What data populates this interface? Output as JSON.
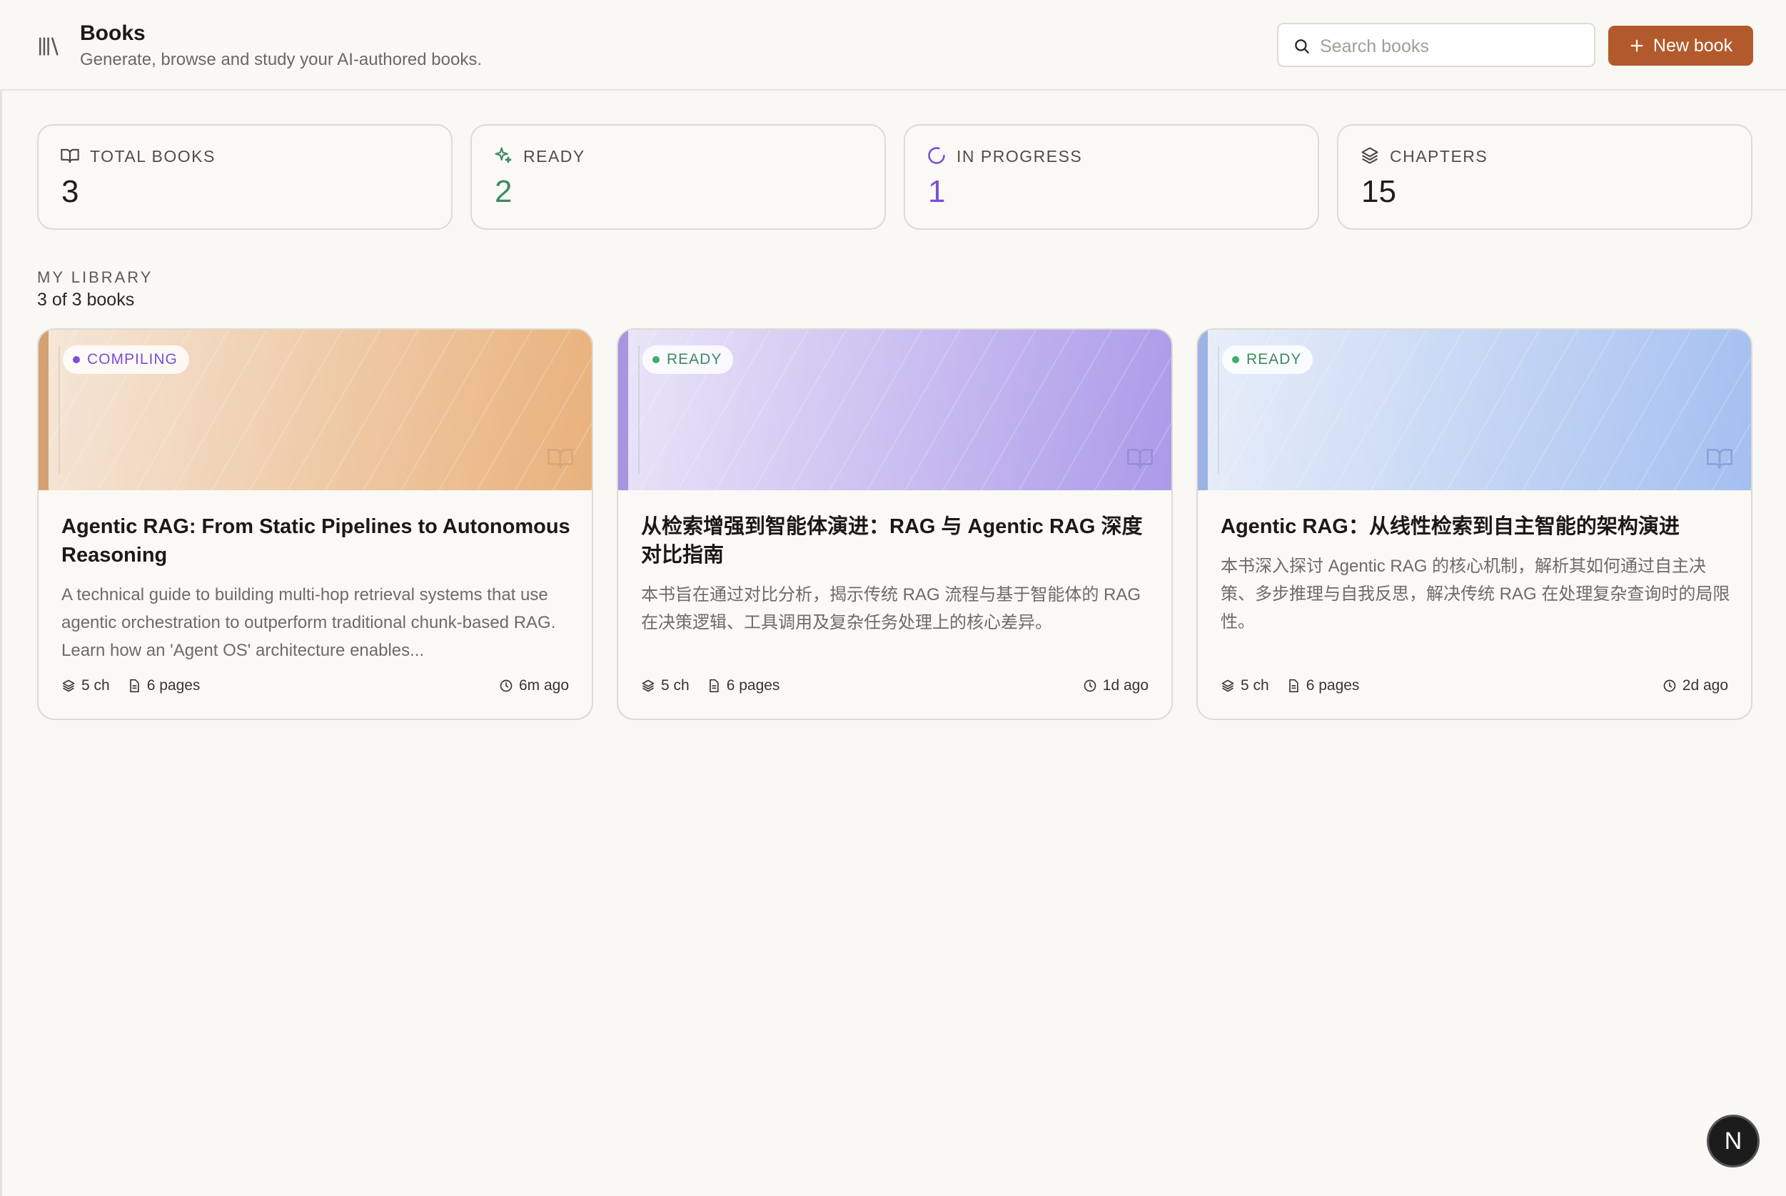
{
  "header": {
    "title": "Books",
    "subtitle": "Generate, browse and study your AI-authored books.",
    "search_placeholder": "Search books",
    "new_button_label": "New book"
  },
  "stats": [
    {
      "label": "TOTAL BOOKS",
      "value": "3",
      "color": "#1f1d1a",
      "icon": "book-open-icon"
    },
    {
      "label": "READY",
      "value": "2",
      "color": "#3f8a60",
      "icon": "sparkles-icon"
    },
    {
      "label": "IN PROGRESS",
      "value": "1",
      "color": "#7a4fd8",
      "icon": "spinner-icon"
    },
    {
      "label": "CHAPTERS",
      "value": "15",
      "color": "#1f1d1a",
      "icon": "layers-icon"
    }
  ],
  "library": {
    "label": "MY LIBRARY",
    "count": "3 of 3 books"
  },
  "books": [
    {
      "status": "COMPILING",
      "status_color": "#7a4fd8",
      "title": "Agentic RAG: From Static Pipelines to Autonomous Reasoning",
      "description": "A technical guide to building multi-hop retrieval systems that use agentic orchestration to outperform traditional chunk-based RAG. Learn how an 'Agent OS' architecture enables...",
      "chapters": "5 ch",
      "pages": "6 pages",
      "updated": "6m ago",
      "cover_from": "#f5e6d6",
      "cover_to": "#e9b27c",
      "icon_color": "#d7a77e"
    },
    {
      "status": "READY",
      "status_color": "#3f8a60",
      "title": "从检索增强到智能体演进：RAG 与 Agentic RAG 深度对比指南",
      "description": "本书旨在通过对比分析，揭示传统 RAG 流程与基于智能体的 RAG 在决策逻辑、工具调用及复杂任务处理上的核心差异。",
      "chapters": "5 ch",
      "pages": "6 pages",
      "updated": "1d ago",
      "cover_from": "#e8e3f8",
      "cover_to": "#ab9ce8",
      "icon_color": "#9a8cd8"
    },
    {
      "status": "READY",
      "status_color": "#3f8a60",
      "title": "Agentic RAG：从线性检索到自主智能的架构演进",
      "description": "本书深入探讨 Agentic RAG 的核心机制，解析其如何通过自主决策、多步推理与自我反思，解决传统 RAG 在处理复杂查询时的局限性。",
      "chapters": "5 ch",
      "pages": "6 pages",
      "updated": "2d ago",
      "cover_from": "#e7eefb",
      "cover_to": "#a6c1ef",
      "icon_color": "#8aa6de"
    }
  ],
  "floating_badge": "N"
}
